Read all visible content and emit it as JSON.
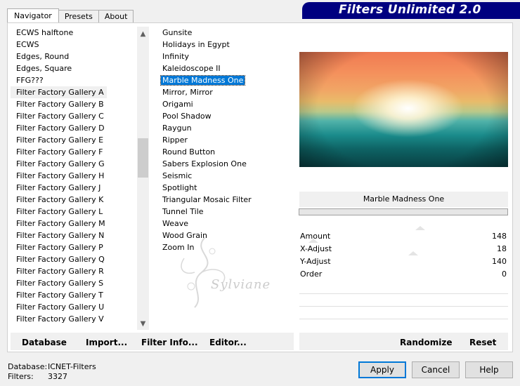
{
  "tabs": [
    {
      "label": "Navigator",
      "active": true
    },
    {
      "label": "Presets",
      "active": false
    },
    {
      "label": "About",
      "active": false
    }
  ],
  "banner_title": "Filters Unlimited 2.0",
  "categories": [
    "ECWS halftone",
    "ECWS",
    "Edges, Round",
    "Edges, Square",
    "FFG???",
    "Filter Factory Gallery A",
    "Filter Factory Gallery B",
    "Filter Factory Gallery C",
    "Filter Factory Gallery D",
    "Filter Factory Gallery E",
    "Filter Factory Gallery F",
    "Filter Factory Gallery G",
    "Filter Factory Gallery H",
    "Filter Factory Gallery J",
    "Filter Factory Gallery K",
    "Filter Factory Gallery L",
    "Filter Factory Gallery M",
    "Filter Factory Gallery N",
    "Filter Factory Gallery P",
    "Filter Factory Gallery Q",
    "Filter Factory Gallery R",
    "Filter Factory Gallery S",
    "Filter Factory Gallery T",
    "Filter Factory Gallery U",
    "Filter Factory Gallery V"
  ],
  "selected_category": "Filter Factory Gallery A",
  "filters": [
    "Gunsite",
    "Holidays in Egypt",
    "Infinity",
    "Kaleidoscope II",
    "Marble Madness One",
    "Mirror, Mirror",
    "Origami",
    "Pool Shadow",
    "Raygun",
    "Ripper",
    "Round Button",
    "Sabers Explosion One",
    "Seismic",
    "Spotlight",
    "Triangular Mosaic Filter",
    "Tunnel Tile",
    "Weave",
    "Wood Grain",
    "Zoom In"
  ],
  "selected_filter": "Marble Madness One",
  "watermark": "Sylviane",
  "filter_name": "Marble Madness One",
  "params": [
    {
      "label": "Amount",
      "value": "148"
    },
    {
      "label": "X-Adjust",
      "value": "18"
    },
    {
      "label": "Y-Adjust",
      "value": "140"
    },
    {
      "label": "Order",
      "value": "0"
    }
  ],
  "left_buttons": {
    "database": "Database",
    "import": "Import...",
    "filter_info": "Filter Info...",
    "editor": "Editor..."
  },
  "right_buttons": {
    "randomize": "Randomize",
    "reset": "Reset"
  },
  "status": {
    "database_label": "Database:",
    "database_value": "ICNET-Filters",
    "filters_label": "Filters:",
    "filters_value": "3327"
  },
  "dialog_buttons": {
    "apply": "Apply",
    "cancel": "Cancel",
    "help": "Help"
  }
}
